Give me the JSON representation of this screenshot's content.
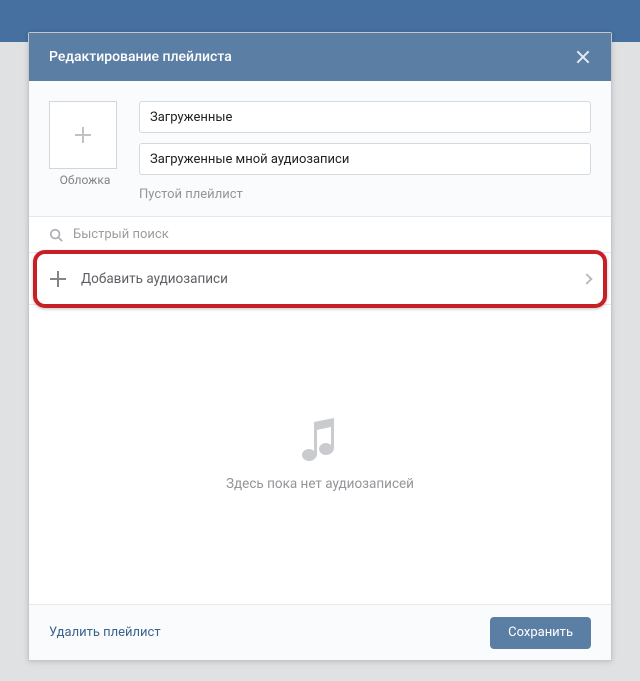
{
  "header": {
    "title": "Редактирование плейлиста"
  },
  "cover": {
    "label": "Обложка"
  },
  "fields": {
    "name_value": "Загруженные",
    "desc_value": "Загруженные мной аудиозаписи",
    "status": "Пустой плейлист"
  },
  "search": {
    "placeholder": "Быстрый поиск"
  },
  "add_row": {
    "label": "Добавить аудиозаписи"
  },
  "empty": {
    "text": "Здесь пока нет аудиозаписей"
  },
  "footer": {
    "delete": "Удалить плейлист",
    "save": "Сохранить"
  }
}
